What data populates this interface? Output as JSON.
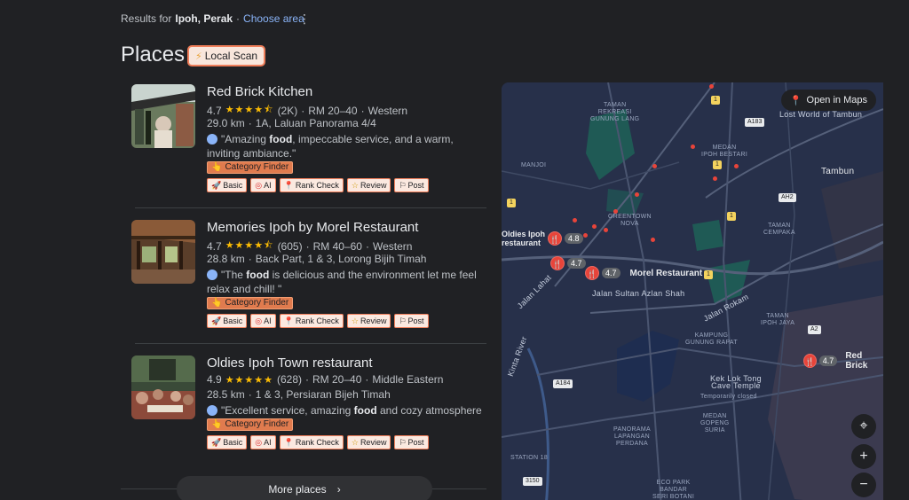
{
  "header": {
    "results_prefix": "Results for",
    "location": "Ipoh, Perak",
    "separator": "·",
    "choose_area": "Choose area",
    "more_icon": "more-vert-icon"
  },
  "title": "Places",
  "local_scan": {
    "label": "Local Scan",
    "icon": "lightning-icon"
  },
  "places": [
    {
      "name": "Red Brick Kitchen",
      "rating": "4.7",
      "stars": "★★★★⯪",
      "reviews": "(2K)",
      "price": "RM 20–40",
      "category": "Western",
      "distance": "29.0 km",
      "address": "1A, Laluan Panorama 4/4",
      "review_pre": "\"Amazing ",
      "review_bold": "food",
      "review_post": ", impeccable service, and a warm, inviting ambiance.\""
    },
    {
      "name": "Memories Ipoh by Morel Restaurant",
      "rating": "4.7",
      "stars": "★★★★⯪",
      "reviews": "(605)",
      "price": "RM 40–60",
      "category": "Western",
      "distance": "28.8 km",
      "address": "Back Part, 1 & 3, Lorong Bijih Timah",
      "review_pre": "\"The ",
      "review_bold": "food",
      "review_post": " is delicious and the environment let me feel relax and chill!  \""
    },
    {
      "name": "Oldies Ipoh Town restaurant",
      "rating": "4.9",
      "stars": "★★★★★",
      "reviews": "(628)",
      "price": "RM 20–40",
      "category": "Middle Eastern",
      "distance": "28.5 km",
      "address": "1 & 3, Persiaran Bijeh Timah",
      "review_pre": "\"Excellent service, amazing ",
      "review_bold": "food",
      "review_post": " and cozy atmosphere 💕\""
    }
  ],
  "category_finder": "Category Finder",
  "tools": [
    {
      "label": "Basic",
      "icon": "rocket-icon"
    },
    {
      "label": "AI",
      "icon": "ai-icon"
    },
    {
      "label": "Rank Check",
      "icon": "pin-icon"
    },
    {
      "label": "Review",
      "icon": "star-icon"
    },
    {
      "label": "Post",
      "icon": "flag-icon"
    }
  ],
  "more_places": "More places",
  "map": {
    "open_in_maps": "Open in Maps",
    "pins": [
      {
        "rating": "4.8",
        "label": "Oldies Ipoh\nrestaurant"
      },
      {
        "rating": "4.7",
        "label": ""
      },
      {
        "rating": "4.7",
        "label": "Morel Restaurant"
      },
      {
        "rating": "4.7",
        "label": "Red Brick"
      }
    ],
    "labels": {
      "taman_rekreasi": "TAMAN\nREKREASI\nGUNUNG LANG",
      "lost_world": "Lost World of Tambun",
      "manjoi": "MANJOI",
      "medan_ipoh_bestari": "MEDAN\nIPOH BESTARI",
      "tambun": "Tambun",
      "greentown": "GREENTOWN\nNOVA",
      "taman_cempaka": "TAMAN\nCEMPAKA",
      "jalan_sultan": "Jalan Sultan Azlan Shah",
      "jalan_rokam": "Jalan Rokam",
      "jalan_lahat": "Jalan Lahat",
      "taman_ipoh_jaya": "TAMAN\nIPOH JAYA",
      "kampung_gunung_rapat": "KAMPUNG\nGUNUNG RAPAT",
      "kinta_river": "Kinta River",
      "kek_lok_tong": "Kek Lok Tong\nCave Temple",
      "temporarily_closed": "Temporarily closed",
      "medan_gopeng": "MEDAN\nGOPENG\nSURIA",
      "panorama": "PANORAMA\nLAPANGAN\nPERDANA",
      "station18": "STATION 18",
      "eco_park": "ECO PARK\nBANDAR\nSERI BOTANI"
    },
    "shields": [
      "1",
      "A183",
      "A2",
      "AH2",
      "1",
      "1",
      "A184",
      "3150",
      "A2",
      "AH2",
      "1"
    ],
    "zoom_in": "+",
    "zoom_out": "−"
  }
}
